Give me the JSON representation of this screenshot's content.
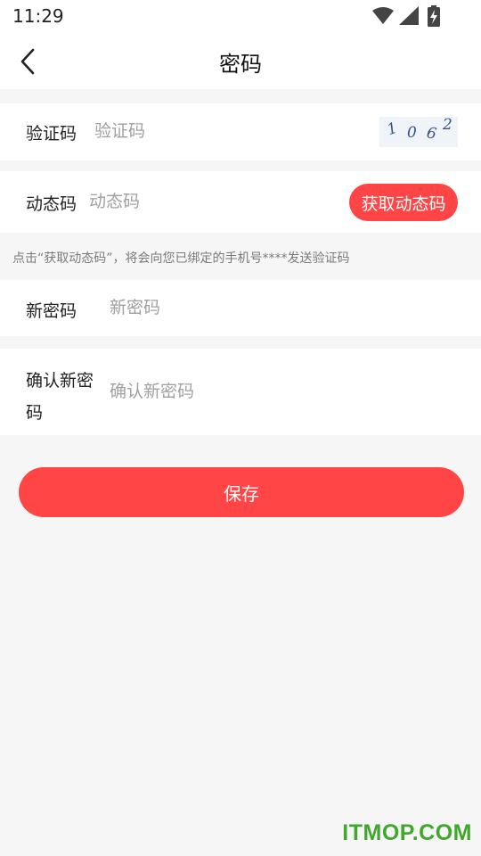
{
  "status_bar": {
    "time": "11:29",
    "icons": [
      "wifi-icon",
      "signal-icon",
      "battery-charging-icon"
    ]
  },
  "header": {
    "title": "密码",
    "back_icon": "chevron-left-icon"
  },
  "form": {
    "captcha": {
      "label": "验证码",
      "placeholder": "验证码",
      "image_chars": [
        "1",
        "0",
        "6",
        "2"
      ]
    },
    "dynamic_code": {
      "label": "动态码",
      "placeholder": "动态码",
      "button_label": "获取动态码"
    },
    "hint": "点击“获取动态码”，将会向您已绑定的手机号****发送验证码",
    "new_password": {
      "label": "新密码",
      "placeholder": "新密码"
    },
    "confirm_password": {
      "label_line1": "确认新密",
      "label_line2": "码",
      "placeholder": "确认新密码"
    }
  },
  "save_button_label": "保存",
  "watermark": "ITMOP.COM",
  "colors": {
    "accent": "#ff4545",
    "background": "#f6f6f6",
    "placeholder": "#a0a0a0",
    "watermark": "#41a82e"
  }
}
